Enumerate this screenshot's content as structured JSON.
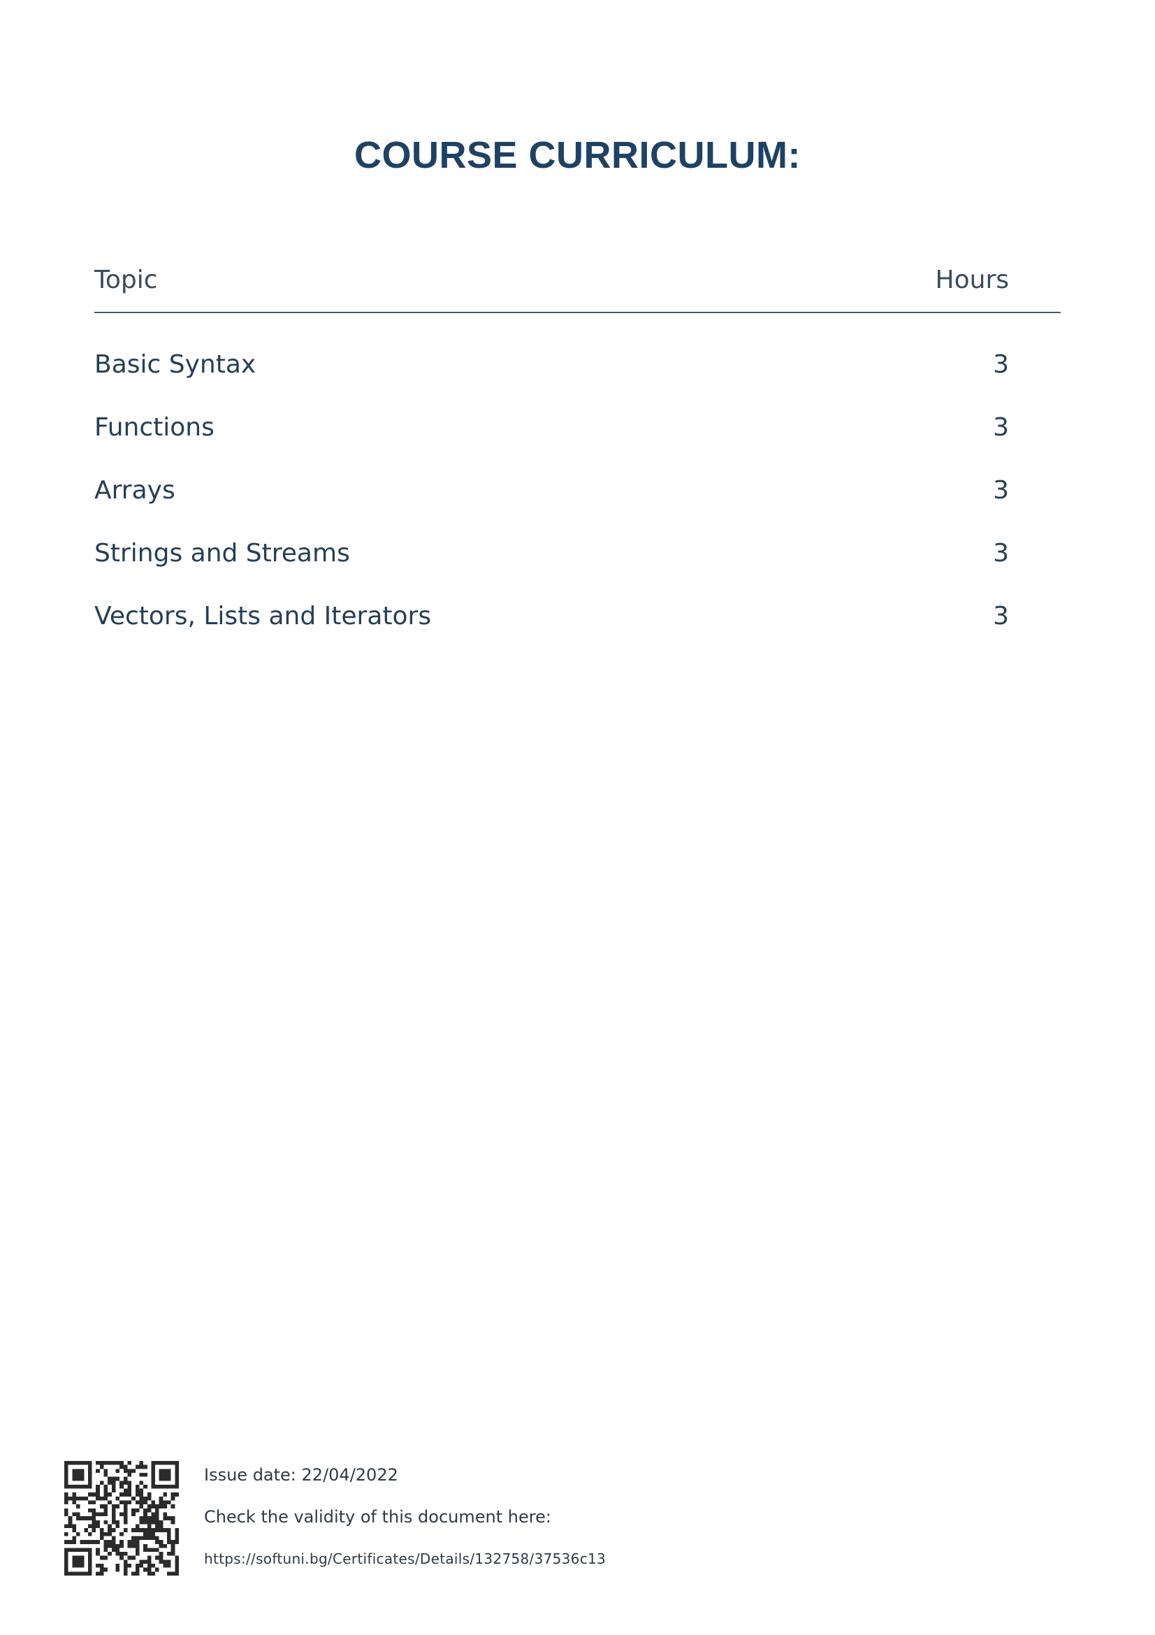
{
  "title": "COURSE CURRICULUM:",
  "table": {
    "headers": {
      "topic": "Topic",
      "hours": "Hours"
    },
    "rows": [
      {
        "topic": "Basic Syntax",
        "hours": "3"
      },
      {
        "topic": "Functions",
        "hours": "3"
      },
      {
        "topic": "Arrays",
        "hours": "3"
      },
      {
        "topic": "Strings and Streams",
        "hours": "3"
      },
      {
        "topic": "Vectors, Lists and Iterators",
        "hours": "3"
      }
    ]
  },
  "footer": {
    "qr_icon": "qr-code-icon",
    "issue_date": "Issue date: 22/04/2022",
    "check_text": "Check the validity of this document here:",
    "url": "https://softuni.bg/Certificates/Details/132758/37536c13"
  },
  "colors": {
    "title": "#1f4164",
    "text": "#263f58",
    "rule": "#4a5663"
  }
}
